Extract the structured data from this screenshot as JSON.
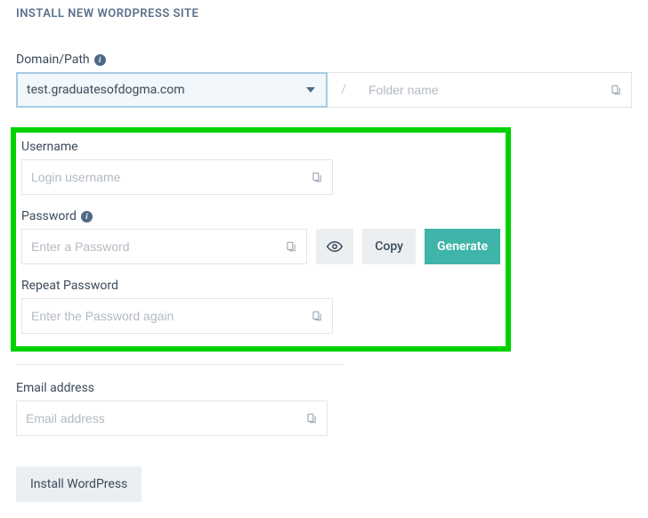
{
  "title": "INSTALL NEW WORDPRESS SITE",
  "domain": {
    "label": "Domain/Path",
    "selected": "test.graduatesofdogma.com",
    "separator": "/",
    "folder_placeholder": "Folder name"
  },
  "username": {
    "label": "Username",
    "placeholder": "Login username"
  },
  "password": {
    "label": "Password",
    "placeholder": "Enter a Password",
    "copy_label": "Copy",
    "generate_label": "Generate"
  },
  "repeat_password": {
    "label": "Repeat Password",
    "placeholder": "Enter the Password again"
  },
  "email": {
    "label": "Email address",
    "placeholder": "Email address"
  },
  "install_label": "Install WordPress",
  "info_char": "i"
}
